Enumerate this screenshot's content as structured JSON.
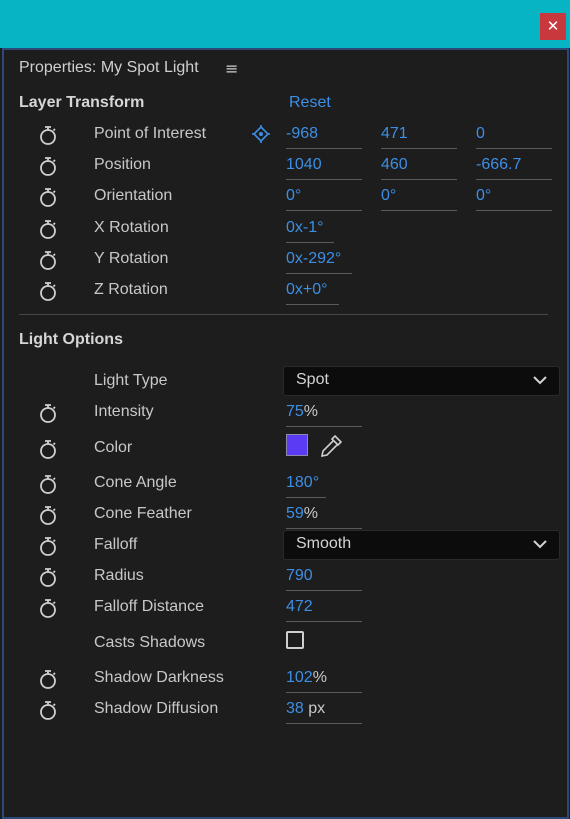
{
  "window": {
    "close_glyph": "✕"
  },
  "panel": {
    "title": "Properties: My Spot Light",
    "menu_icon": "≡"
  },
  "layer_transform": {
    "heading": "Layer Transform",
    "reset_label": "Reset",
    "rows": [
      {
        "label": "Point of Interest",
        "values": [
          "-968",
          "471",
          "0"
        ]
      },
      {
        "label": "Position",
        "values": [
          "1040",
          "460",
          "-666.7"
        ]
      },
      {
        "label": "Orientation",
        "values": [
          "0°",
          "0°",
          "0°"
        ]
      },
      {
        "label": "X Rotation",
        "prefix": "0x",
        "value": "-1°"
      },
      {
        "label": "Y Rotation",
        "prefix": "0x",
        "value": "-292°"
      },
      {
        "label": "Z Rotation",
        "prefix": "0x",
        "value": "+0°"
      }
    ]
  },
  "light_options": {
    "heading": "Light Options",
    "light_type": {
      "label": "Light Type",
      "selected": "Spot"
    },
    "intensity": {
      "label": "Intensity",
      "value": "75",
      "unit": "%"
    },
    "color": {
      "label": "Color",
      "swatch": "#5b3cf4"
    },
    "cone_angle": {
      "label": "Cone Angle",
      "value": "180°"
    },
    "cone_feather": {
      "label": "Cone Feather",
      "value": "59",
      "unit": "%"
    },
    "falloff": {
      "label": "Falloff",
      "selected": "Smooth"
    },
    "radius": {
      "label": "Radius",
      "value": "790"
    },
    "falloff_distance": {
      "label": "Falloff Distance",
      "value": "472"
    },
    "casts_shadows": {
      "label": "Casts Shadows",
      "checked": false
    },
    "shadow_darkness": {
      "label": "Shadow Darkness",
      "value": "102",
      "unit": "%"
    },
    "shadow_diffusion": {
      "label": "Shadow Diffusion",
      "value": "38",
      "unit": "px"
    }
  },
  "colors": {
    "accent": "#3d8fe5",
    "titlebar": "#06b4c4",
    "close": "#c8383d",
    "background": "#1d1d1d"
  }
}
